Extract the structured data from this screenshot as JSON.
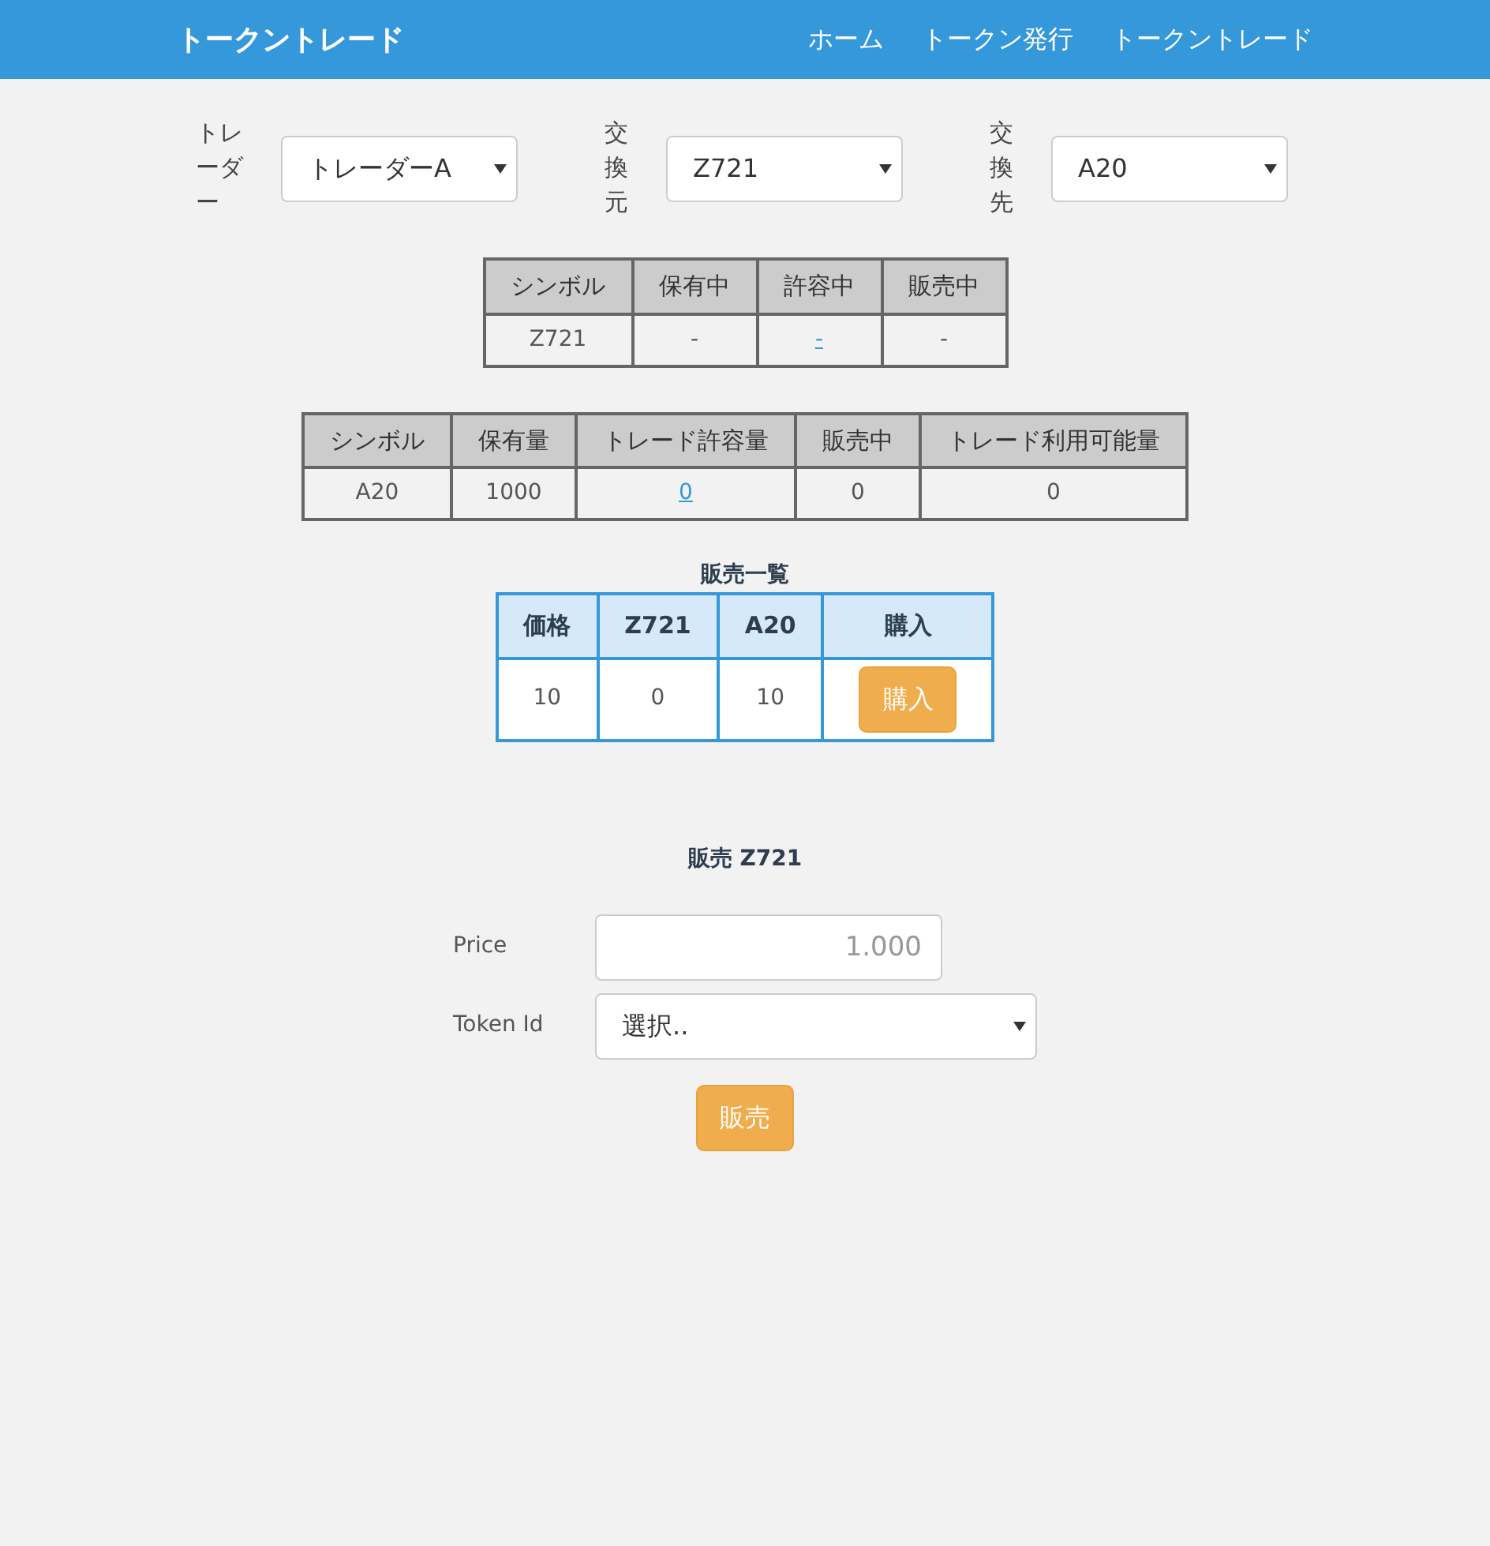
{
  "navbar": {
    "brand": "トークントレード",
    "links": [
      {
        "label": "ホーム",
        "selected": false
      },
      {
        "label": "トークン発行",
        "selected": false
      },
      {
        "label": "トークントレード",
        "selected": false
      }
    ]
  },
  "filters": [
    {
      "label": "トレーダー",
      "value": "トレーダーA"
    },
    {
      "label": "交換元",
      "value": "Z721"
    },
    {
      "label": "交換先",
      "value": "A20"
    }
  ],
  "source_table": {
    "columns": [
      "シンボル",
      "保有中",
      "許容中",
      "販売中"
    ],
    "rows": [
      [
        {
          "text": "Z721",
          "link": false
        },
        {
          "text": "-",
          "link": false
        },
        {
          "text": "-",
          "link": true
        },
        {
          "text": "-",
          "link": false
        }
      ]
    ]
  },
  "target_table": {
    "columns": [
      "シンボル",
      "保有量",
      "トレード許容量",
      "販売中",
      "トレード利用可能量"
    ],
    "rows": [
      [
        {
          "text": "A20",
          "link": false
        },
        {
          "text": "1000",
          "link": false
        },
        {
          "text": "0",
          "link": true
        },
        {
          "text": "0",
          "link": false
        },
        {
          "text": "0",
          "link": false
        }
      ]
    ]
  },
  "sales_list": {
    "title": "販売一覧",
    "columns": [
      "価格",
      "Z721",
      "A20",
      "購入"
    ],
    "rows": [
      {
        "cells": [
          "10",
          "0",
          "10"
        ],
        "button": "購入"
      }
    ]
  },
  "sell_form": {
    "title": "販売 Z721",
    "price": {
      "label": "Price",
      "placeholder": "1.000"
    },
    "token_id": {
      "label": "Token Id",
      "value": "選択.."
    },
    "button": "販売"
  }
}
